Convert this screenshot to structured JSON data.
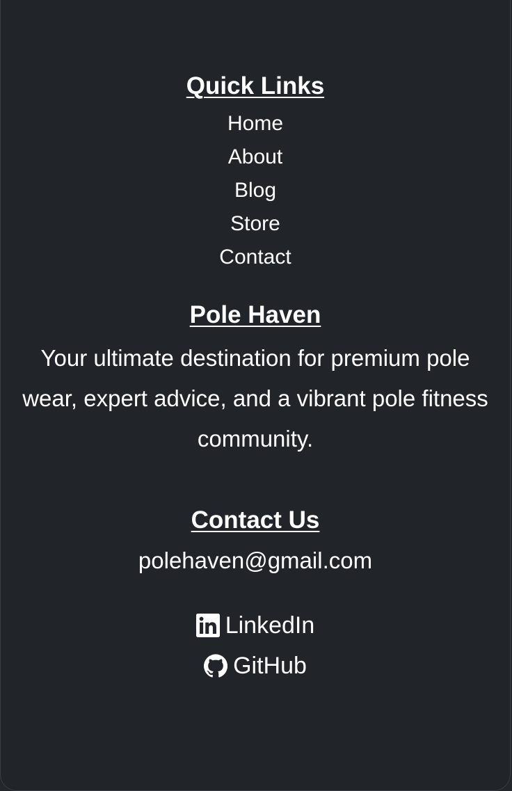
{
  "quick_links": {
    "title": "Quick Links",
    "items": [
      {
        "label": "Home"
      },
      {
        "label": "About"
      },
      {
        "label": "Blog"
      },
      {
        "label": "Store"
      },
      {
        "label": "Contact"
      }
    ]
  },
  "about": {
    "title": "Pole Haven",
    "description": "Your ultimate destination for premium pole wear, expert advice, and a vibrant pole fitness community."
  },
  "contact": {
    "title": "Contact Us",
    "email": "polehaven@gmail.com"
  },
  "social": {
    "linkedin": {
      "label": "LinkedIn",
      "icon": "linkedin-icon"
    },
    "github": {
      "label": "GitHub",
      "icon": "github-icon"
    }
  },
  "colors": {
    "background": "#212429",
    "text": "#ffffff"
  }
}
